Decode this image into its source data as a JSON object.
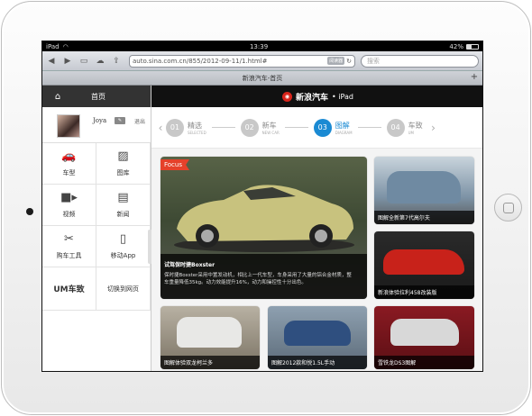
{
  "status": {
    "carrier": "iPad",
    "wifi_icon": "wifi-icon",
    "time": "13:39",
    "battery": "42%"
  },
  "browser": {
    "url": "auto.sina.com.cn/855/2012-09-11/1.html#",
    "reader_label": "阅读器",
    "search_placeholder": "搜索",
    "tab_title": "新浪汽车-首页",
    "new_tab_label": "+"
  },
  "sidebar": {
    "home_label": "首页",
    "user": {
      "name": "Joya",
      "logout": "退出"
    },
    "items": [
      {
        "label": "车型",
        "icon": "car-icon"
      },
      {
        "label": "图库",
        "icon": "gallery-icon"
      },
      {
        "label": "视频",
        "icon": "video-camera-icon"
      },
      {
        "label": "新闻",
        "icon": "news-icon"
      },
      {
        "label": "购车工具",
        "icon": "tools-icon"
      },
      {
        "label": "移动App",
        "icon": "phone-icon"
      },
      {
        "label": "UM车致",
        "icon": "um-logo"
      },
      {
        "label": "切换到网页",
        "icon": ""
      }
    ]
  },
  "brand": {
    "name": "新浪汽车",
    "suffix": "• iPad"
  },
  "steps": [
    {
      "num": "01",
      "title": "精选",
      "sub": "SELECTED"
    },
    {
      "num": "02",
      "title": "新车",
      "sub": "NEW CAR"
    },
    {
      "num": "03",
      "title": "图解",
      "sub": "DIAGRAM"
    },
    {
      "num": "04",
      "title": "车致",
      "sub": "UM"
    }
  ],
  "focus": {
    "tag": "Focus",
    "title": "试驾保时捷Boxster",
    "desc": "保时捷Boxster采用中置发动机，相比上一代车型，车身采用了大量的铝合金材质，整车重量降低35kg。动力效能提升16%，动力和操控性十分出色。"
  },
  "cards": [
    {
      "caption": "图解全新第7代高尔夫",
      "color": "#7d93a6"
    },
    {
      "caption": "新浪体验拉利458改装版",
      "color": "#b23a33"
    },
    {
      "caption": "图解体验双龙柯兰多",
      "color": "#a9a49a"
    },
    {
      "caption": "图解2012款和悦1.5L手动",
      "color": "#6e7b8f"
    },
    {
      "caption": "雪铁龙DS3图解",
      "color": "#9c2630"
    }
  ],
  "accent": "#1a8ad3"
}
